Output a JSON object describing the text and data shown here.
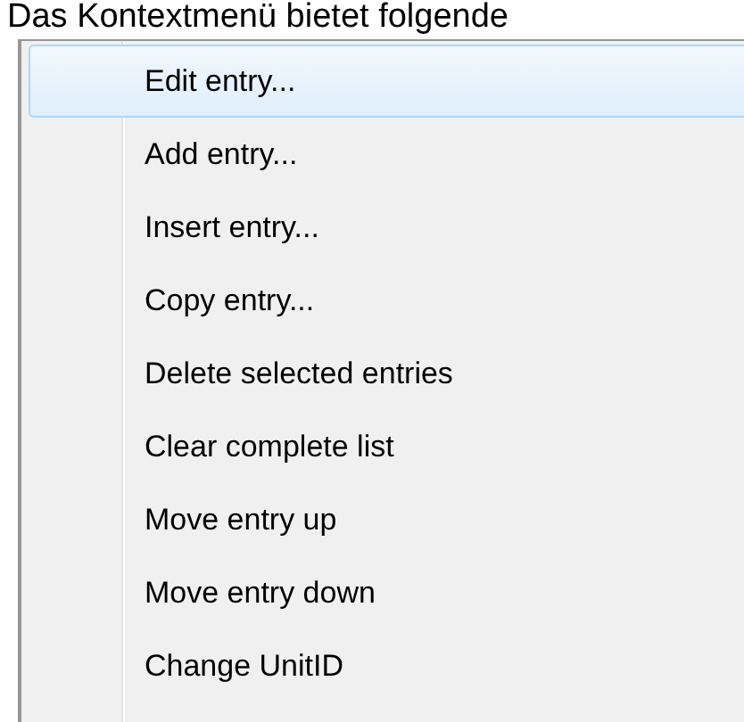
{
  "intro_text": "Das Kontextmenü bietet folgende",
  "context_menu": {
    "items": [
      {
        "label": "Edit entry...",
        "selected": true
      },
      {
        "label": "Add entry...",
        "selected": false
      },
      {
        "label": "Insert entry...",
        "selected": false
      },
      {
        "label": "Copy entry...",
        "selected": false
      },
      {
        "label": "Delete selected entries",
        "selected": false
      },
      {
        "label": "Clear complete list",
        "selected": false
      },
      {
        "label": "Move entry up",
        "selected": false
      },
      {
        "label": "Move entry down",
        "selected": false
      },
      {
        "label": "Change UnitID",
        "selected": false
      }
    ]
  }
}
